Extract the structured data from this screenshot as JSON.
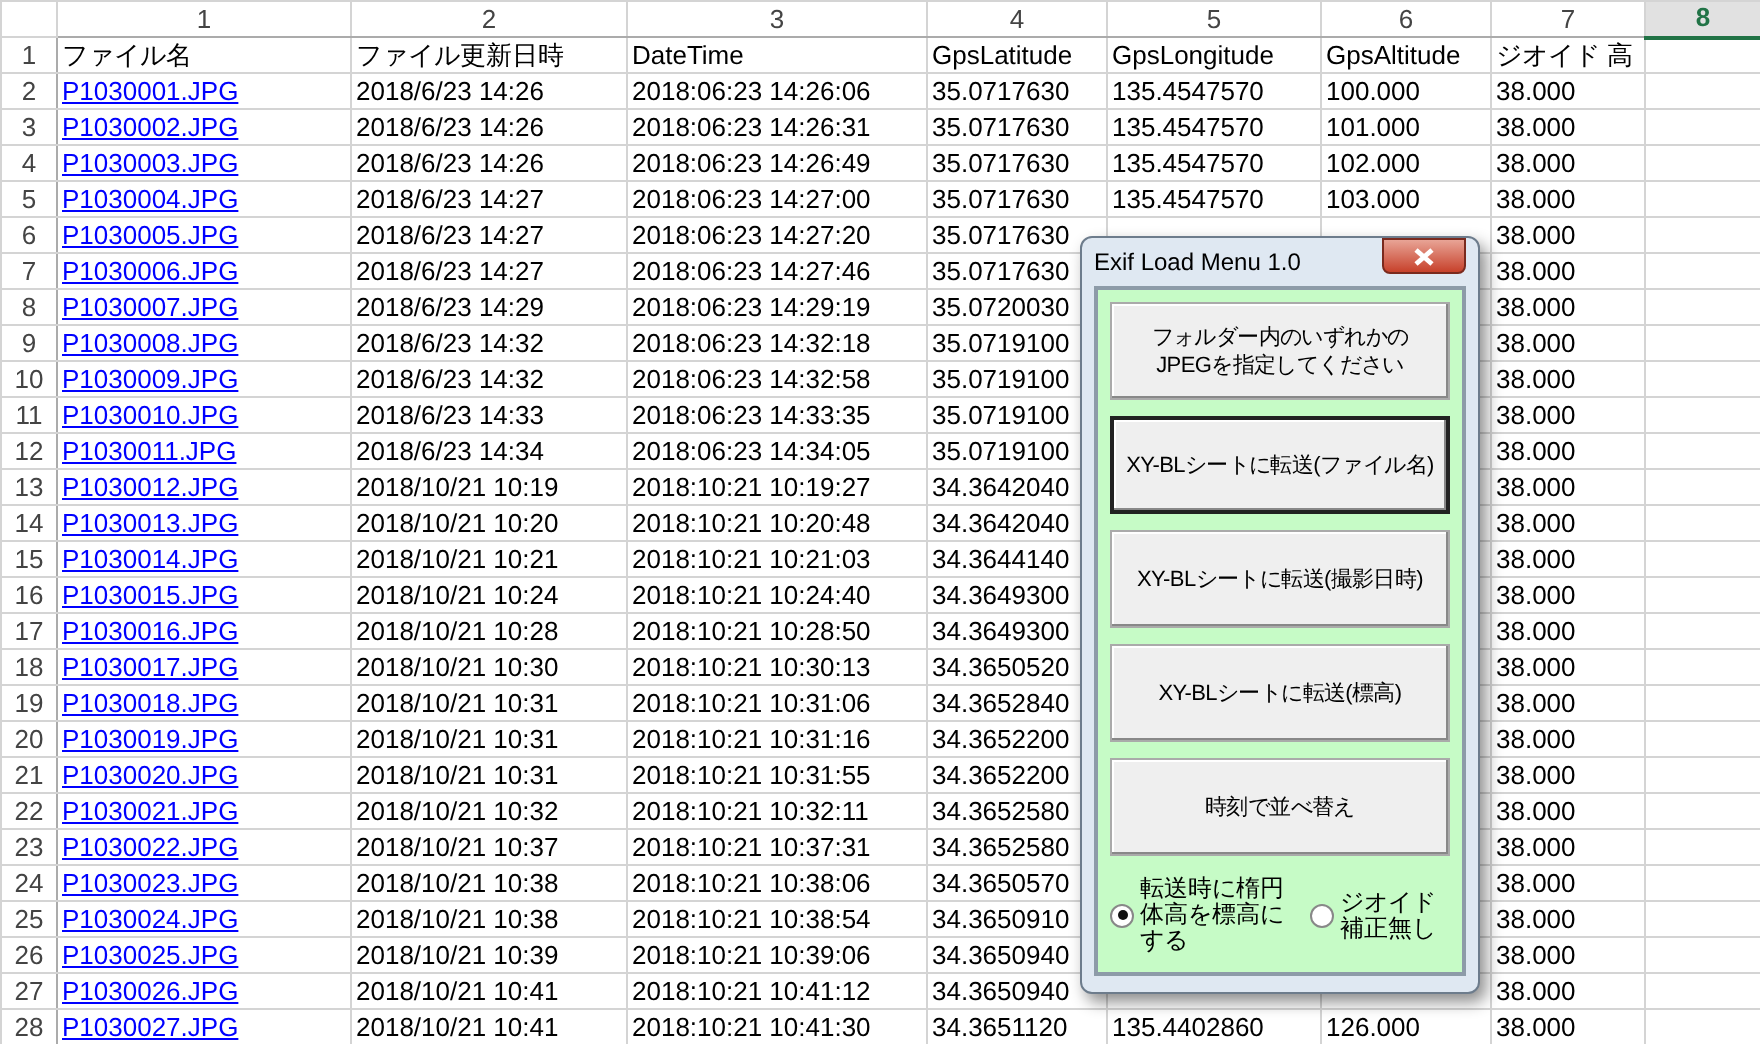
{
  "columns": [
    {
      "label": "1",
      "selected": false
    },
    {
      "label": "2",
      "selected": false
    },
    {
      "label": "3",
      "selected": false
    },
    {
      "label": "4",
      "selected": false
    },
    {
      "label": "5",
      "selected": false
    },
    {
      "label": "6",
      "selected": false
    },
    {
      "label": "7",
      "selected": false
    },
    {
      "label": "8",
      "selected": true
    }
  ],
  "header_row": {
    "number": "1",
    "cells": [
      "ファイル名",
      "ファイル更新日時",
      "DateTime",
      "GpsLatitude",
      "GpsLongitude",
      "GpsAltitude",
      "ジオイド 高"
    ]
  },
  "rows": [
    {
      "number": "2",
      "file": "P1030001.JPG",
      "modified": "2018/6/23 14:26",
      "datetime": "2018:06:23 14:26:06",
      "latitude": "35.0717630",
      "longitude": "135.4547570",
      "altitude": "100.000",
      "geoid": "38.000"
    },
    {
      "number": "3",
      "file": "P1030002.JPG",
      "modified": "2018/6/23 14:26",
      "datetime": "2018:06:23 14:26:31",
      "latitude": "35.0717630",
      "longitude": "135.4547570",
      "altitude": "101.000",
      "geoid": "38.000"
    },
    {
      "number": "4",
      "file": "P1030003.JPG",
      "modified": "2018/6/23 14:26",
      "datetime": "2018:06:23 14:26:49",
      "latitude": "35.0717630",
      "longitude": "135.4547570",
      "altitude": "102.000",
      "geoid": "38.000"
    },
    {
      "number": "5",
      "file": "P1030004.JPG",
      "modified": "2018/6/23 14:27",
      "datetime": "2018:06:23 14:27:00",
      "latitude": "35.0717630",
      "longitude": "135.4547570",
      "altitude": "103.000",
      "geoid": "38.000"
    },
    {
      "number": "6",
      "file": "P1030005.JPG",
      "modified": "2018/6/23 14:27",
      "datetime": "2018:06:23 14:27:20",
      "latitude": "35.0717630",
      "geoid": "38.000"
    },
    {
      "number": "7",
      "file": "P1030006.JPG",
      "modified": "2018/6/23 14:27",
      "datetime": "2018:06:23 14:27:46",
      "latitude": "35.0717630",
      "geoid": "38.000"
    },
    {
      "number": "8",
      "file": "P1030007.JPG",
      "modified": "2018/6/23 14:29",
      "datetime": "2018:06:23 14:29:19",
      "latitude": "35.0720030",
      "geoid": "38.000"
    },
    {
      "number": "9",
      "file": "P1030008.JPG",
      "modified": "2018/6/23 14:32",
      "datetime": "2018:06:23 14:32:18",
      "latitude": "35.0719100",
      "geoid": "38.000"
    },
    {
      "number": "10",
      "file": "P1030009.JPG",
      "modified": "2018/6/23 14:32",
      "datetime": "2018:06:23 14:32:58",
      "latitude": "35.0719100",
      "geoid": "38.000"
    },
    {
      "number": "11",
      "file": "P1030010.JPG",
      "modified": "2018/6/23 14:33",
      "datetime": "2018:06:23 14:33:35",
      "latitude": "35.0719100",
      "geoid": "38.000"
    },
    {
      "number": "12",
      "file": "P1030011.JPG",
      "modified": "2018/6/23 14:34",
      "datetime": "2018:06:23 14:34:05",
      "latitude": "35.0719100",
      "geoid": "38.000"
    },
    {
      "number": "13",
      "file": "P1030012.JPG",
      "modified": "2018/10/21 10:19",
      "datetime": "2018:10:21 10:19:27",
      "latitude": "34.3642040",
      "geoid": "38.000"
    },
    {
      "number": "14",
      "file": "P1030013.JPG",
      "modified": "2018/10/21 10:20",
      "datetime": "2018:10:21 10:20:48",
      "latitude": "34.3642040",
      "geoid": "38.000"
    },
    {
      "number": "15",
      "file": "P1030014.JPG",
      "modified": "2018/10/21 10:21",
      "datetime": "2018:10:21 10:21:03",
      "latitude": "34.3644140",
      "geoid": "38.000"
    },
    {
      "number": "16",
      "file": "P1030015.JPG",
      "modified": "2018/10/21 10:24",
      "datetime": "2018:10:21 10:24:40",
      "latitude": "34.3649300",
      "geoid": "38.000"
    },
    {
      "number": "17",
      "file": "P1030016.JPG",
      "modified": "2018/10/21 10:28",
      "datetime": "2018:10:21 10:28:50",
      "latitude": "34.3649300",
      "geoid": "38.000"
    },
    {
      "number": "18",
      "file": "P1030017.JPG",
      "modified": "2018/10/21 10:30",
      "datetime": "2018:10:21 10:30:13",
      "latitude": "34.3650520",
      "geoid": "38.000"
    },
    {
      "number": "19",
      "file": "P1030018.JPG",
      "modified": "2018/10/21 10:31",
      "datetime": "2018:10:21 10:31:06",
      "latitude": "34.3652840",
      "geoid": "38.000"
    },
    {
      "number": "20",
      "file": "P1030019.JPG",
      "modified": "2018/10/21 10:31",
      "datetime": "2018:10:21 10:31:16",
      "latitude": "34.3652200",
      "geoid": "38.000"
    },
    {
      "number": "21",
      "file": "P1030020.JPG",
      "modified": "2018/10/21 10:31",
      "datetime": "2018:10:21 10:31:55",
      "latitude": "34.3652200",
      "geoid": "38.000"
    },
    {
      "number": "22",
      "file": "P1030021.JPG",
      "modified": "2018/10/21 10:32",
      "datetime": "2018:10:21 10:32:11",
      "latitude": "34.3652580",
      "geoid": "38.000"
    },
    {
      "number": "23",
      "file": "P1030022.JPG",
      "modified": "2018/10/21 10:37",
      "datetime": "2018:10:21 10:37:31",
      "latitude": "34.3652580",
      "geoid": "38.000"
    },
    {
      "number": "24",
      "file": "P1030023.JPG",
      "modified": "2018/10/21 10:38",
      "datetime": "2018:10:21 10:38:06",
      "latitude": "34.3650570",
      "geoid": "38.000"
    },
    {
      "number": "25",
      "file": "P1030024.JPG",
      "modified": "2018/10/21 10:38",
      "datetime": "2018:10:21 10:38:54",
      "latitude": "34.3650910",
      "geoid": "38.000"
    },
    {
      "number": "26",
      "file": "P1030025.JPG",
      "modified": "2018/10/21 10:39",
      "datetime": "2018:10:21 10:39:06",
      "latitude": "34.3650940",
      "geoid": "38.000"
    },
    {
      "number": "27",
      "file": "P1030026.JPG",
      "modified": "2018/10/21 10:41",
      "datetime": "2018:10:21 10:41:12",
      "latitude": "34.3650940",
      "geoid": "38.000"
    },
    {
      "number": "28",
      "file": "P1030027.JPG",
      "modified": "2018/10/21 10:41",
      "datetime": "2018:10:21 10:41:30",
      "latitude": "34.3651120",
      "longitude": "135.4402860",
      "altitude": "126.000",
      "geoid": "38.000"
    }
  ],
  "dialog": {
    "title": "Exif Load Menu 1.0",
    "buttons": [
      {
        "label": "フォルダー内のいずれかの\nJPEGを指定してください",
        "focused": false
      },
      {
        "label": "XY-BLシートに転送(ファイル名)",
        "focused": true
      },
      {
        "label": "XY-BLシートに転送(撮影日時)",
        "focused": false
      },
      {
        "label": "XY-BLシートに転送(標高)",
        "focused": false
      },
      {
        "label": "時刻で並べ替え",
        "focused": false
      }
    ],
    "radios": [
      {
        "label": "転送時に楕円体高を標高にする",
        "selected": true
      },
      {
        "label": "ジオイド補正無し",
        "selected": false
      }
    ]
  }
}
